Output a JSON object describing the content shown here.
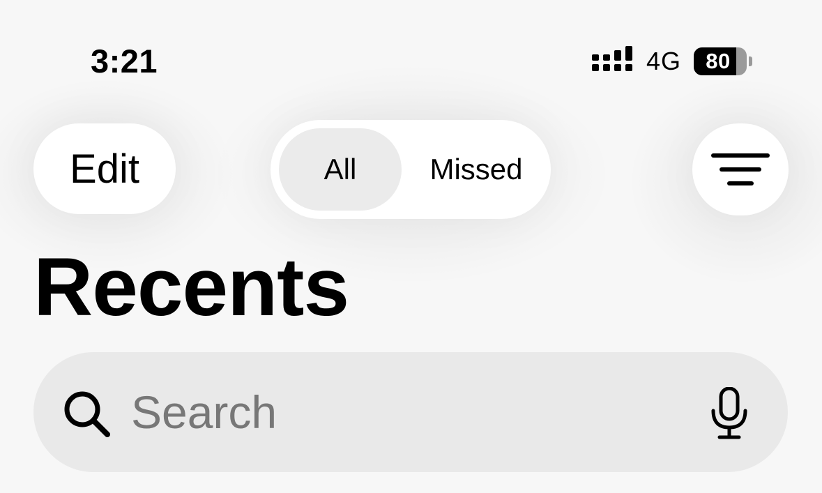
{
  "status_bar": {
    "time": "3:21",
    "network": "4G",
    "battery_percent": 80,
    "battery_label": "80",
    "signal_icon": "cellular-signal-icon"
  },
  "nav": {
    "edit_label": "Edit",
    "segments": [
      {
        "label": "All",
        "selected": true
      },
      {
        "label": "Missed",
        "selected": false
      }
    ],
    "filter_icon": "filter-lines-icon"
  },
  "page": {
    "title": "Recents"
  },
  "search": {
    "placeholder": "Search",
    "value": "",
    "search_icon": "magnifier-icon",
    "mic_icon": "microphone-icon"
  },
  "colors": {
    "background": "#f7f7f7",
    "control_bg": "#ffffff",
    "selected_segment": "#ebebeb",
    "search_bg": "#e9e9e9",
    "placeholder": "#777777"
  }
}
